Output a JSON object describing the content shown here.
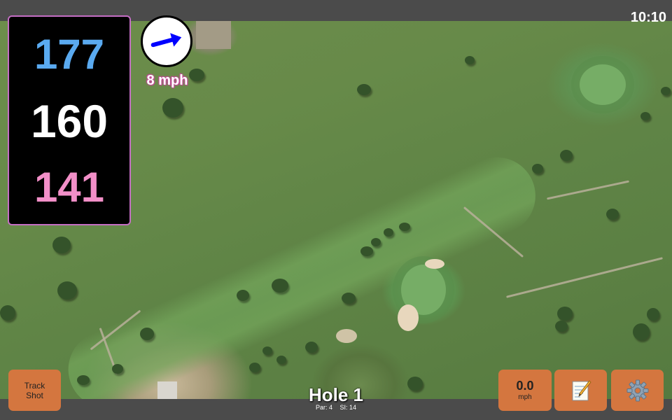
{
  "status": {
    "time": "10:10"
  },
  "distances": {
    "back": "177",
    "middle": "160",
    "front": "141"
  },
  "wind": {
    "speed_label": "8 mph",
    "direction_deg": -15,
    "arrow_color": "#0000ff"
  },
  "buttons": {
    "track_shot_line1": "Track",
    "track_shot_line2": "Shot",
    "speed_value": "0.0",
    "speed_unit": "mph"
  },
  "hole": {
    "title": "Hole 1",
    "par_label": "Par: 4",
    "si_label": "SI: 14"
  },
  "icons": {
    "notes": "notes-icon",
    "settings": "gear-icon"
  },
  "colors": {
    "button_bg": "#d4763f",
    "back_distance": "#5aaaf0",
    "middle_distance": "#ffffff",
    "front_distance": "#f28fc8",
    "panel_border": "#c46ec4"
  }
}
